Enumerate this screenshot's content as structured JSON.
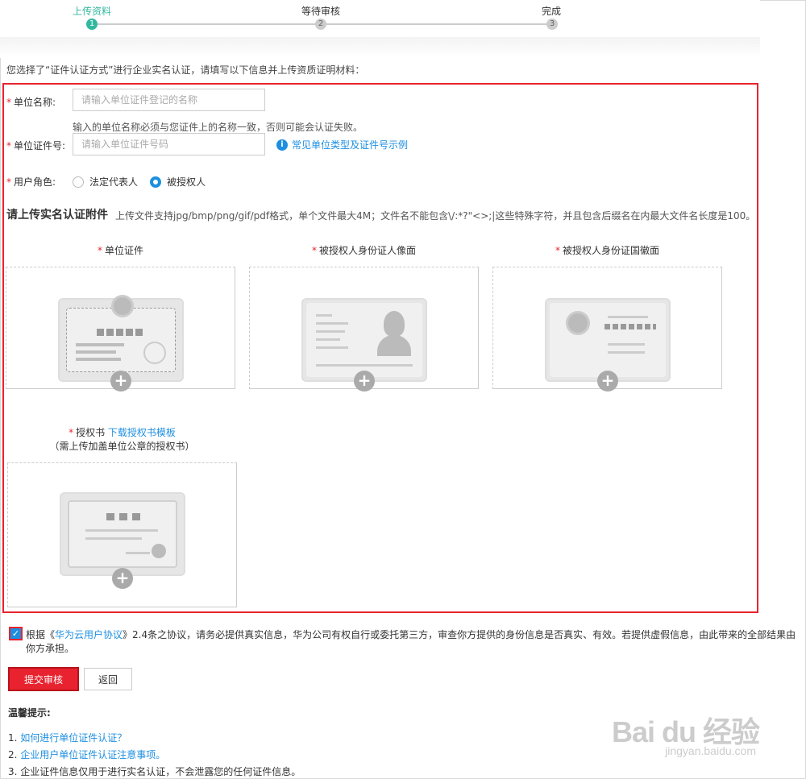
{
  "steps": [
    {
      "label": "上传资料",
      "num": "1"
    },
    {
      "label": "等待审核",
      "num": "2"
    },
    {
      "label": "完成",
      "num": "3"
    }
  ],
  "intro": "您选择了“证件认证方式”进行企业实名认证，请填写以下信息并上传资质证明材料：",
  "form": {
    "req_mark": "*",
    "name_label": "单位名称:",
    "name_placeholder": "请输入单位证件登记的名称",
    "name_hint": "输入的单位名称必须与您证件上的名称一致，否则可能会认证失败。",
    "id_label": "单位证件号:",
    "id_placeholder": "请输入单位证件号码",
    "id_example_link": "常见单位类型及证件号示例",
    "info_icon_glyph": "i",
    "role_label": "用户角色:",
    "role_options": [
      {
        "label": "法定代表人",
        "checked": false
      },
      {
        "label": "被授权人",
        "checked": true
      }
    ]
  },
  "upload": {
    "title": "请上传实名认证附件",
    "desc": "上传文件支持jpg/bmp/png/gif/pdf格式，单个文件最大4M；文件名不能包含\\/:*?\"<>;|这些特殊字符，并且包含后缀名在内最大文件名长度是100。",
    "slots": [
      {
        "req": "*",
        "label": "单位证件"
      },
      {
        "req": "*",
        "label": "被授权人身份证人像面"
      },
      {
        "req": "*",
        "label": "被授权人身份证国徽面"
      },
      {
        "req": "*",
        "label": "授权书",
        "link": "下载授权书模板",
        "sub": "（需上传加盖单位公章的授权书）"
      }
    ],
    "plus_glyph": "+"
  },
  "agreement": {
    "checked": true,
    "check_glyph": "✓",
    "prefix": "根据《",
    "link": "华为云用户协议",
    "suffix": "》2.4条之协议，请务必提供真实信息，华为公司有权自行或委托第三方，审查你方提供的身份信息是否真实、有效。若提供虚假信息，由此带来的全部结果由你方承担。"
  },
  "buttons": {
    "submit": "提交审核",
    "back": "返回"
  },
  "tips": {
    "title": "温馨提示:",
    "items": [
      {
        "num": "1. ",
        "text": "如何进行单位证件认证？",
        "is_link": true
      },
      {
        "num": "2. ",
        "text": "企业用户单位证件认证注意事项。",
        "is_link": true
      },
      {
        "num": "3. ",
        "text": "企业证件信息仅用于进行实名认证，不会泄露您的任何证件信息。",
        "is_link": false
      }
    ]
  },
  "watermark": {
    "main": "Bai du 经验",
    "sub": "jingyan.baidu.com"
  },
  "colors": {
    "accent": "#33b8a0",
    "link": "#1e8fe0",
    "danger": "#e8232f"
  }
}
